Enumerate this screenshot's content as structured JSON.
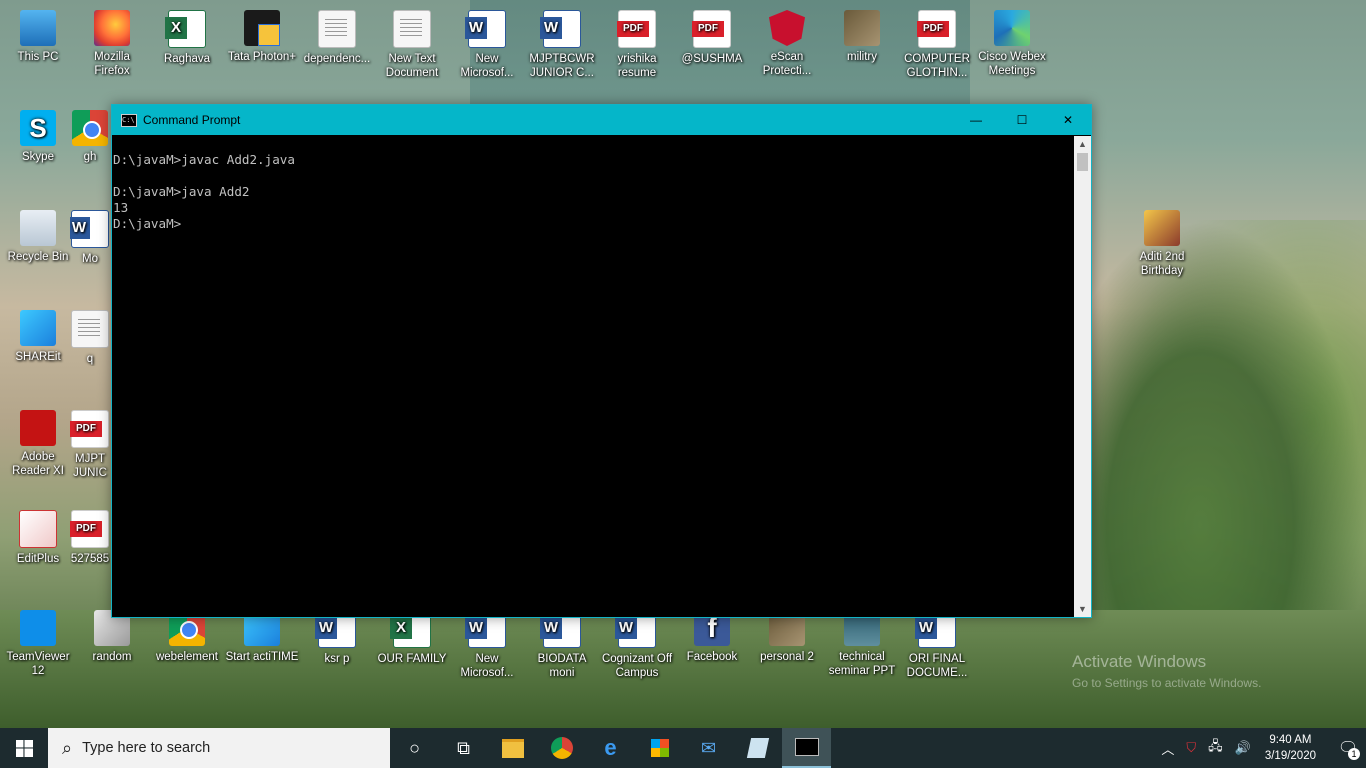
{
  "desktop": {
    "top_row": [
      {
        "label": "This PC",
        "icon": "pc-icon"
      },
      {
        "label": "Mozilla Firefox",
        "icon": "firefox-icon"
      },
      {
        "label": "Raghava",
        "icon": "excel-icon"
      },
      {
        "label": "Tata Photon+",
        "icon": "tata-photon-icon"
      },
      {
        "label": "dependenc...",
        "icon": "text-file-icon"
      },
      {
        "label": "New Text Document",
        "icon": "text-file-icon"
      },
      {
        "label": "New Microsof...",
        "icon": "word-icon"
      },
      {
        "label": "MJPTBCWR JUNIOR C...",
        "icon": "word-icon"
      },
      {
        "label": "yrishika resume",
        "icon": "pdf-icon"
      },
      {
        "label": "@SUSHMA",
        "icon": "pdf-icon"
      },
      {
        "label": "eScan Protecti...",
        "icon": "escan-icon"
      },
      {
        "label": "militry",
        "icon": "photo-icon"
      },
      {
        "label": "COMPUTER GLOTHIN...",
        "icon": "pdf-icon"
      },
      {
        "label": "Cisco Webex Meetings",
        "icon": "webex-icon"
      }
    ],
    "left_col": [
      {
        "label": "Skype",
        "icon": "skype-icon"
      },
      {
        "label": "Recycle Bin",
        "icon": "recycle-bin-icon"
      },
      {
        "label": "SHAREit",
        "icon": "shareit-icon"
      },
      {
        "label": "Adobe Reader XI",
        "icon": "adobe-reader-icon"
      },
      {
        "label": "EditPlus",
        "icon": "editplus-icon"
      }
    ],
    "second_col": [
      {
        "label": "gh",
        "icon": "chrome-icon"
      },
      {
        "label": "Mo",
        "icon": "word-icon"
      },
      {
        "label": "q",
        "icon": "text-file-icon"
      },
      {
        "label": "MJPT JUNIC",
        "icon": "pdf-icon"
      },
      {
        "label": "527585",
        "icon": "pdf-icon"
      }
    ],
    "bottom_row": [
      {
        "label": "TeamViewer 12",
        "icon": "teamviewer-icon"
      },
      {
        "label": "random",
        "icon": "generic-file-icon"
      },
      {
        "label": "webelement",
        "icon": "chrome-icon"
      },
      {
        "label": "Start actiTIME",
        "icon": "actitime-icon"
      },
      {
        "label": "ksr p",
        "icon": "word-icon"
      },
      {
        "label": "OUR FAMILY",
        "icon": "excel-icon"
      },
      {
        "label": "New Microsof...",
        "icon": "word-icon"
      },
      {
        "label": "BIODATA moni",
        "icon": "word-icon"
      },
      {
        "label": "Cognizant Off Campus",
        "icon": "word-icon"
      },
      {
        "label": "Facebook",
        "icon": "facebook-icon"
      },
      {
        "label": "personal 2",
        "icon": "photo-icon"
      },
      {
        "label": "technical seminar PPT",
        "icon": "presentation-icon"
      },
      {
        "label": "ORI FINAL DOCUME...",
        "icon": "word-icon"
      }
    ],
    "right_side": [
      {
        "label": "Aditi 2nd Birthday",
        "icon": "folder-photo-icon"
      }
    ],
    "watermark": {
      "line1": "Activate Windows",
      "line2": "Go to Settings to activate Windows."
    }
  },
  "cmd_window": {
    "title": "Command Prompt",
    "app_icon_text": "C:\\",
    "minimize": "—",
    "maximize": "☐",
    "close": "✕",
    "lines": [
      "D:\\javaM>javac Add2.java",
      "",
      "D:\\javaM>java Add2",
      "13",
      "D:\\javaM>"
    ]
  },
  "taskbar": {
    "search_placeholder": "Type here to search",
    "apps": [
      {
        "name": "cortana-button",
        "icon": "○"
      },
      {
        "name": "task-view-button",
        "icon": "⧉"
      },
      {
        "name": "file-explorer-button",
        "icon": "📁"
      },
      {
        "name": "chrome-taskbar-button",
        "icon": "◉"
      },
      {
        "name": "edge-taskbar-button",
        "icon": "e"
      },
      {
        "name": "store-taskbar-button",
        "icon": "🛍"
      },
      {
        "name": "mail-taskbar-button",
        "icon": "✉"
      },
      {
        "name": "notes-taskbar-button",
        "icon": "▱"
      },
      {
        "name": "cmd-taskbar-button",
        "icon": "▭"
      }
    ],
    "time": "9:40 AM",
    "date": "3/19/2020",
    "notification_count": "1"
  }
}
